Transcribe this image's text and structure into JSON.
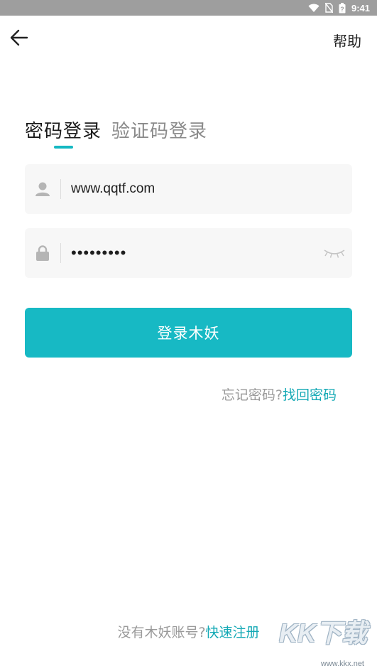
{
  "status_bar": {
    "time": "9:41",
    "icons": [
      "wifi-icon",
      "no-sim-icon",
      "battery-icon"
    ]
  },
  "header": {
    "back_icon": "arrow-left-icon",
    "help_label": "帮助"
  },
  "tabs": {
    "password_login": "密码登录",
    "code_login": "验证码登录",
    "active": "password_login"
  },
  "form": {
    "username_value": "www.qqtf.com",
    "password_value": "•••••••••",
    "user_icon": "user-icon",
    "lock_icon": "lock-icon",
    "eye_icon": "eye-closed-icon"
  },
  "login_button": "登录木妖",
  "forgot": {
    "question": "忘记密码?",
    "link": "找回密码"
  },
  "register": {
    "question": "没有木妖账号?",
    "link": "快速注册"
  },
  "watermark": {
    "logo": "KK下载",
    "url": "www.kkx.net"
  },
  "colors": {
    "accent": "#17b9c4",
    "link": "#14a9b5",
    "field_bg": "#f7f7f7",
    "status_bar": "#9e9e9e"
  }
}
